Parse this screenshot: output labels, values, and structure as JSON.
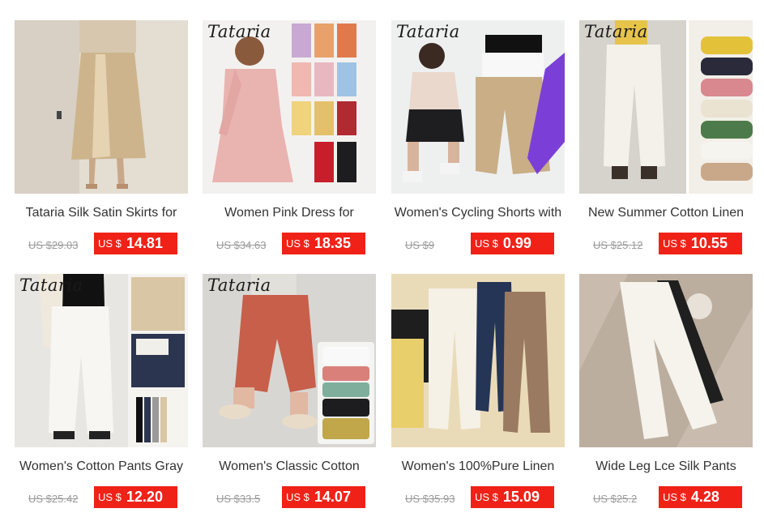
{
  "products": [
    {
      "title": "Tataria Silk Satin Skirts for",
      "original_price": "US $29.03",
      "currency": "US $",
      "price": "14.81",
      "brand_mark": "",
      "image_icon": "satin-skirt-photo-icon"
    },
    {
      "title": "Women Pink Dress for",
      "original_price": "US $34.63",
      "currency": "US $",
      "price": "18.35",
      "brand_mark": "Tataria",
      "image_icon": "pink-dress-photo-icon"
    },
    {
      "title": "Women's Cycling Shorts with",
      "original_price": "US $9",
      "currency": "US $",
      "price": "0.99",
      "brand_mark": "Tataria",
      "image_icon": "cycling-shorts-photo-icon"
    },
    {
      "title": "New Summer Cotton Linen",
      "original_price": "US $25.12",
      "currency": "US $",
      "price": "10.55",
      "brand_mark": "Tataria",
      "image_icon": "linen-pants-photo-icon"
    },
    {
      "title": "Women's Cotton Pants Gray",
      "original_price": "US $25.42",
      "currency": "US $",
      "price": "12.20",
      "brand_mark": "Tataria",
      "image_icon": "cotton-pants-photo-icon"
    },
    {
      "title": "Women's Classic Cotton",
      "original_price": "US $33.5",
      "currency": "US $",
      "price": "14.07",
      "brand_mark": "Tataria",
      "image_icon": "harem-pants-photo-icon"
    },
    {
      "title": "Women's 100%Pure Linen",
      "original_price": "US $35.93",
      "currency": "US $",
      "price": "15.09",
      "brand_mark": "",
      "image_icon": "pure-linen-pants-photo-icon"
    },
    {
      "title": "Wide Leg Lce Silk Pants",
      "original_price": "US $25.2",
      "currency": "US $",
      "price": "4.28",
      "brand_mark": "",
      "image_icon": "silk-pants-photo-icon"
    }
  ],
  "colors": {
    "price_badge": "#f02218",
    "original_price": "#9a9a9a",
    "title": "#333333"
  }
}
